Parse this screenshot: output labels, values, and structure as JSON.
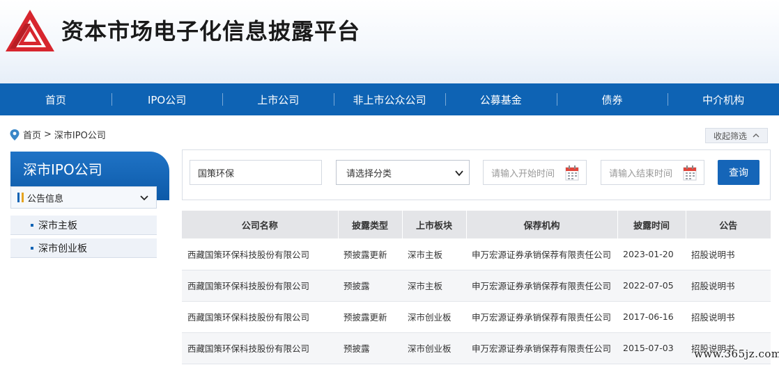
{
  "header": {
    "site_title": "资本市场电子化信息披露平台",
    "logo_icon": "triangle-logo-icon"
  },
  "nav": {
    "items": [
      {
        "label": "首页"
      },
      {
        "label": "IPO公司"
      },
      {
        "label": "上市公司"
      },
      {
        "label": "非上市公众公司"
      },
      {
        "label": "公募基金"
      },
      {
        "label": "债券"
      },
      {
        "label": "中介机构"
      }
    ]
  },
  "breadcrumb": {
    "home": "首页",
    "separator": ">",
    "current": "深市IPO公司"
  },
  "collapse_label": "收起筛选",
  "sidebar": {
    "title": "深市IPO公司",
    "section": "公告信息",
    "items": [
      {
        "label": "深市主板"
      },
      {
        "label": "深市创业板"
      }
    ]
  },
  "filter": {
    "company_value": "国策环保",
    "category_selected": "请选择分类",
    "start_placeholder": "请输入开始时间",
    "end_placeholder": "请输入结束时间",
    "search_label": "查询"
  },
  "table": {
    "headers": [
      "公司名称",
      "披露类型",
      "上市板块",
      "保荐机构",
      "披露时间",
      "公告"
    ],
    "rows": [
      [
        "西藏国策环保科技股份有限公司",
        "预披露更新",
        "深市主板",
        "申万宏源证券承销保荐有限责任公司",
        "2023-01-20",
        "招股说明书"
      ],
      [
        "西藏国策环保科技股份有限公司",
        "预披露",
        "深市主板",
        "申万宏源证券承销保荐有限责任公司",
        "2022-07-05",
        "招股说明书"
      ],
      [
        "西藏国策环保科技股份有限公司",
        "预披露更新",
        "深市创业板",
        "申万宏源证券承销保荐有限责任公司",
        "2017-06-16",
        "招股说明书"
      ],
      [
        "西藏国策环保科技股份有限公司",
        "预披露",
        "深市创业板",
        "申万宏源证券承销保荐有限责任公司",
        "2015-07-03",
        "招股说明书"
      ]
    ]
  },
  "watermark": "www.365jz.com",
  "colors": {
    "brand_blue": "#0e63b4",
    "logo_red": "#d7262e",
    "header_bg": "#f3f7fc"
  }
}
